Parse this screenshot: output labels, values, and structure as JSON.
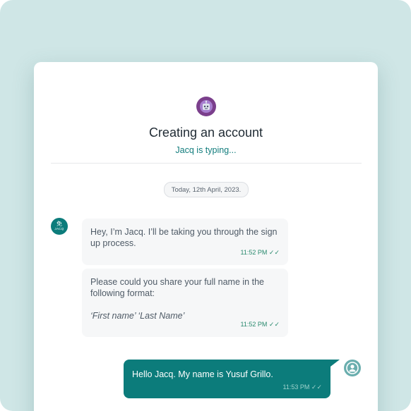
{
  "header": {
    "title": "Creating an account",
    "status": "Jacq is typing...",
    "bot_icon": "robot-icon"
  },
  "chat": {
    "date_label": "Today, 12th April, 2023.",
    "bot_avatar": {
      "logo": "免",
      "label": "JACQ"
    },
    "messages": [
      {
        "sender": "bot",
        "text": "Hey, I’m Jacq. I’ll be taking you through the sign up process.",
        "time": "11:52 PM",
        "status_icon": "double-check-icon"
      },
      {
        "sender": "bot",
        "text_line1": "Please could you share your full name in the following format:",
        "text_line2": "‘First name’ ‘Last Name’",
        "time": "11:52 PM",
        "status_icon": "double-check-icon"
      },
      {
        "sender": "user",
        "text": "Hello Jacq. My name is Yusuf Grillo.",
        "time": "11:53 PM",
        "status_icon": "double-check-icon"
      }
    ],
    "user_avatar_icon": "user-icon"
  },
  "colors": {
    "background": "#cfe6e6",
    "accent": "#0c7c7b",
    "bubble_bg": "#f6f7f8",
    "bot_icon_bg": "#7b3f8c"
  }
}
